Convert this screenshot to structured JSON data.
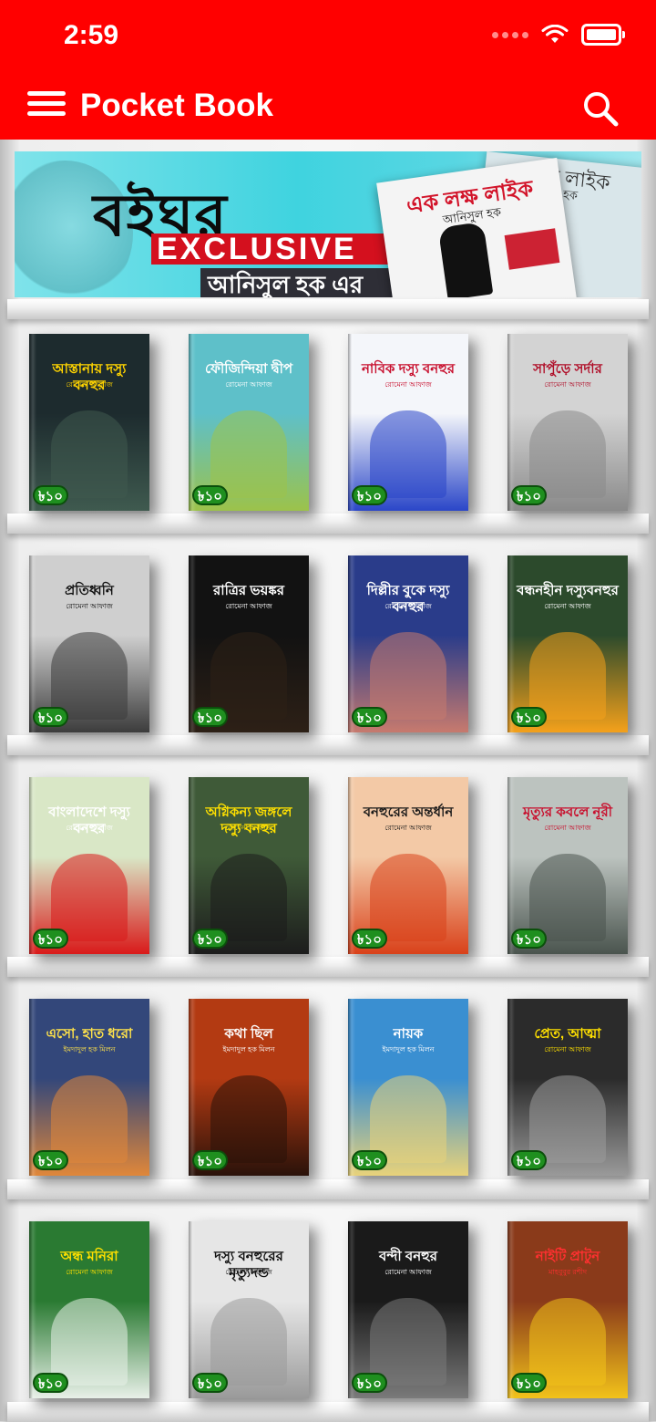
{
  "status": {
    "time": "2:59"
  },
  "app": {
    "title": "Pocket Book"
  },
  "banner": {
    "title_bn": "বইঘর",
    "title_en": "EXCLUSIVE",
    "author_line": "আনিসুল হক এর",
    "book_title": "এক লক্ষ লাইক",
    "book_author": "আনিসুল হক",
    "back_book_title": "ক্ষ লাইক",
    "back_book_author": "সুল হক"
  },
  "shelves": [
    {
      "books": [
        {
          "title": "আস্তানায় দস্যু বনহুর",
          "author": "রোমেনা আফাজ",
          "price": "৳১০",
          "bg": "#1d2b2e",
          "accent": "#3f5a4f",
          "title_color": "#ffd400"
        },
        {
          "title": "ফৌজিন্দিয়া দ্বীপ",
          "author": "রোমেনা আফাজ",
          "price": "৳১০",
          "bg": "#5ec0c9",
          "accent": "#9cc24a",
          "title_color": "#ffffff"
        },
        {
          "title": "নাবিক দস্যু বনহুর",
          "author": "রোমেনা আফাজ",
          "price": "৳১০",
          "bg": "#f4f6fa",
          "accent": "#2a46c8",
          "title_color": "#c8102e"
        },
        {
          "title": "সাপুঁড়ে সর্দার",
          "author": "রোমেনা আফাজ",
          "price": "৳১০",
          "bg": "#d3d3d3",
          "accent": "#8a8a8a",
          "title_color": "#b0102a"
        }
      ]
    },
    {
      "books": [
        {
          "title": "প্রতিধ্বনি",
          "author": "রোমেনা আফাজ",
          "price": "৳১০",
          "bg": "#cfcfcf",
          "accent": "#3c3c3c",
          "title_color": "#111111"
        },
        {
          "title": "রাত্রির ভয়ঙ্কর",
          "author": "রোমেনা আফাজ",
          "price": "৳১০",
          "bg": "#121212",
          "accent": "#2d2016",
          "title_color": "#ffffff"
        },
        {
          "title": "দিল্লীর বুকে দস্যু বনহুর",
          "author": "রোমেনা আফাজ",
          "price": "৳১০",
          "bg": "#2a3c8a",
          "accent": "#c77a6e",
          "title_color": "#ffffff"
        },
        {
          "title": "বন্ধনহীন দস্যুবনহুর",
          "author": "রোমেনা আফাজ",
          "price": "৳১০",
          "bg": "#2c4a2c",
          "accent": "#f4a11b",
          "title_color": "#ffffff"
        }
      ]
    },
    {
      "books": [
        {
          "title": "বাংলাদেশে দস্যু বনহুর",
          "author": "রোমেনা আফাজ",
          "price": "৳১০",
          "bg": "#d9e7c6",
          "accent": "#d91a1a",
          "title_color": "#ffffff"
        },
        {
          "title": "অগ্নিকন্য জঙ্গলে দস্যু বনহুর",
          "author": "রোমেনা আফাজ",
          "price": "৳১০",
          "bg": "#3f5a38",
          "accent": "#1c1c1c",
          "title_color": "#ffe000"
        },
        {
          "title": "বনহুরের অন্তর্ধান",
          "author": "রোমেনা আফাজ",
          "price": "৳১০",
          "bg": "#f3c9a6",
          "accent": "#d9411a",
          "title_color": "#1a1a1a"
        },
        {
          "title": "মৃত্যুর কবলে নূরী",
          "author": "রোমেনা আফাজ",
          "price": "৳১০",
          "bg": "#bcc3bf",
          "accent": "#4a544e",
          "title_color": "#c8102e"
        }
      ]
    },
    {
      "books": [
        {
          "title": "এসো, হাত ধরো",
          "author": "ইমদাদুল হক মিলন",
          "price": "৳১০",
          "bg": "#33477a",
          "accent": "#e0873a",
          "title_color": "#ffe24a"
        },
        {
          "title": "কথা ছিল",
          "author": "ইমদাদুল হক মিলন",
          "price": "৳১০",
          "bg": "#b33a12",
          "accent": "#2a120a",
          "title_color": "#ffffff"
        },
        {
          "title": "নায়ক",
          "author": "ইমদাদুল হক মিলন",
          "price": "৳১০",
          "bg": "#3a8fd1",
          "accent": "#e8d27a",
          "title_color": "#ffffff"
        },
        {
          "title": "প্রেত, আত্মা",
          "author": "রোমেনা আফাজ",
          "price": "৳১০",
          "bg": "#2b2b2b",
          "accent": "#9a9a9a",
          "title_color": "#ffe000"
        }
      ]
    },
    {
      "books": [
        {
          "title": "অন্ধ মনিরা",
          "author": "রোমেনা আফাজ",
          "price": "৳১০",
          "bg": "#2a7a32",
          "accent": "#e8f0e8",
          "title_color": "#ffe000"
        },
        {
          "title": "দস্যু বনহুরের মৃত্যুদন্ড",
          "author": "রোমেনা আফাজ",
          "price": "৳১০",
          "bg": "#e6e6e6",
          "accent": "#9a9a9a",
          "title_color": "#111111"
        },
        {
          "title": "বন্দী বনহুর",
          "author": "রোমেনা আফাজ",
          "price": "৳১০",
          "bg": "#1a1a1a",
          "accent": "#7a7a7a",
          "title_color": "#ffffff"
        },
        {
          "title": "নাইটি প্রাটুন",
          "author": "মাহবুবুর রশীদ",
          "price": "৳১০",
          "bg": "#8a3a1a",
          "accent": "#f2c21a",
          "title_color": "#ff3030"
        }
      ]
    }
  ]
}
